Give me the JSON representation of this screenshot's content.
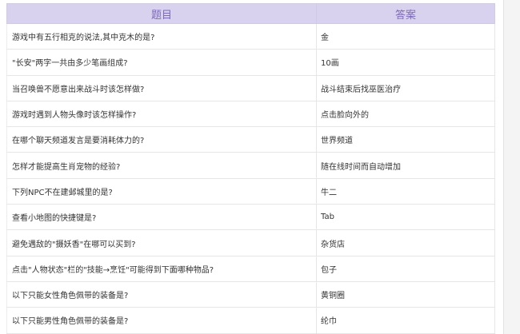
{
  "table": {
    "headers": [
      "题目",
      "答案"
    ],
    "rows": [
      {
        "question": "游戏中有五行相克的说法,其中克木的是?",
        "answer": "金"
      },
      {
        "question": "\"长安\"两字一共由多少笔画组成?",
        "answer": "10画"
      },
      {
        "question": "当召唤兽不愿意出来战斗时该怎样做?",
        "answer": "战斗结束后找巫医治疗"
      },
      {
        "question": "游戏时遇到人物头像时该怎样操作?",
        "answer": "点击脸向外的"
      },
      {
        "question": "在哪个聊天频道发言是要消耗体力的?",
        "answer": "世界频道"
      },
      {
        "question": "怎样才能提高生肖宠物的经验?",
        "answer": "随在线时间而自动增加"
      },
      {
        "question": "下列NPC不在建邺城里的是?",
        "answer": "牛二"
      },
      {
        "question": "查看小地图的快捷键是?",
        "answer": "Tab"
      },
      {
        "question": "避免遇敌的\"摄妖香\"在哪可以买到?",
        "answer": "杂货店"
      },
      {
        "question": "点击\"人物状态\"栏的\"技能→烹饪\"可能得到下面哪种物品?",
        "answer": "包子"
      },
      {
        "question": "以下只能女性角色佩带的装备是?",
        "answer": "黄铜圈"
      },
      {
        "question": "以下只能男性角色佩带的装备是?",
        "answer": "纶巾"
      }
    ]
  },
  "colors": {
    "header_bg": "#d9d2ee",
    "header_text": "#7c6ab7"
  }
}
